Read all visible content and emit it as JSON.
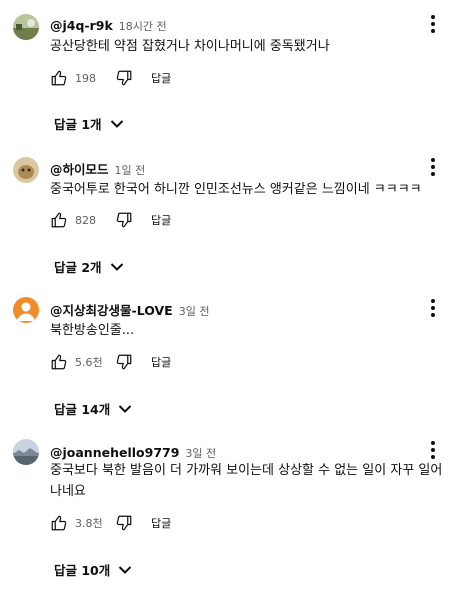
{
  "comments": [
    {
      "author": "@j4q-r9k",
      "time": "18시간 전",
      "text": "공산당한테 약점 잡혔거나 차이나머니에 중독됐거나",
      "likes": "198",
      "reply_label": "답글",
      "replies_label": "답글 1개",
      "avatar_color": "#8a9a6b"
    },
    {
      "author": "@하이모드",
      "time": "1일 전",
      "text": "중국어투로 한국어 하니깐 인민조선뉴스 앵커같은 느낌이네 ㅋㅋㅋㅋ",
      "likes": "828",
      "reply_label": "답글",
      "replies_label": "답글 2개",
      "avatar_color": "#c9b48a"
    },
    {
      "author": "@지상최강생물-LOVE",
      "time": "3일 전",
      "text": "북한방송인줄...",
      "likes": "5.6천",
      "reply_label": "답글",
      "replies_label": "답글 14개",
      "avatar_color": "#f28c28"
    },
    {
      "author": "@joannehello9779",
      "time": "3일 전",
      "text": "중국보다 북한 발음이 더 가까워 보이는데 상상할 수 없는 일이 자꾸 일어나네요",
      "likes": "3.8천",
      "reply_label": "답글",
      "replies_label": "답글 10개",
      "avatar_color": "#9aa7b5"
    }
  ],
  "icons": {
    "like": "thumb-up-icon",
    "dislike": "thumb-down-icon",
    "more": "more-vert-icon",
    "expand": "chevron-down-icon"
  },
  "colors": {
    "text": "#0f0f0f",
    "secondary": "#606060",
    "background": "#ffffff"
  }
}
